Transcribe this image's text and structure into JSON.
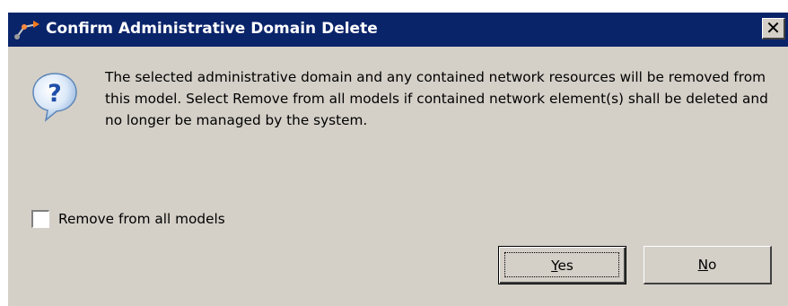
{
  "dialog": {
    "title": "Confirm Administrative Domain Delete",
    "close_glyph": "✕",
    "title_icon": "app-arrow-icon",
    "message_icon": "question-icon",
    "question_glyph": "?",
    "message": "The selected administrative domain and any contained network resources will be removed from this model. Select Remove from all models if contained network element(s) shall be deleted and no longer be managed by the system.",
    "checkbox": {
      "label": "Remove from all models",
      "checked": false
    },
    "buttons": {
      "yes_mnemonic": "Y",
      "yes_rest": "es",
      "no_mnemonic": "N",
      "no_rest": "o"
    }
  },
  "colors": {
    "titlebar": "#0a246a",
    "face": "#d4d0c8",
    "icon_blue": "#3a7bd5"
  }
}
